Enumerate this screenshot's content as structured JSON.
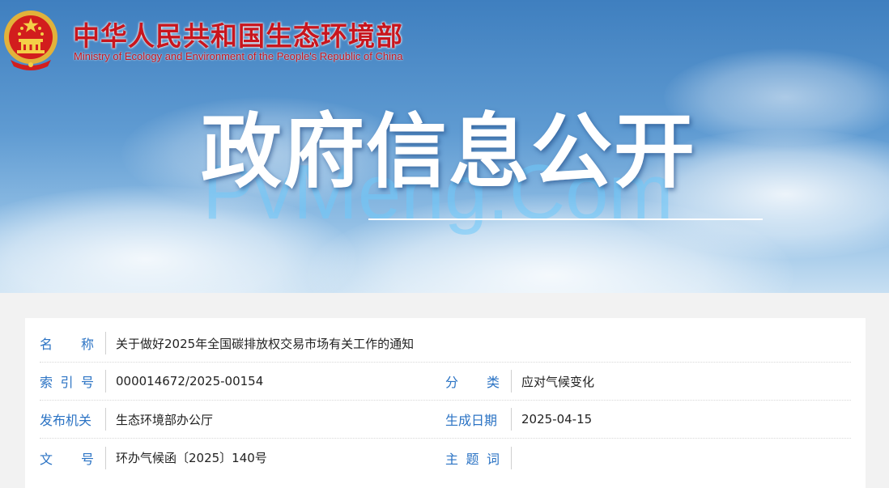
{
  "header": {
    "title_cn": "中华人民共和国生态环境部",
    "title_en": "Ministry of Ecology and Environment of the People's Republic of China",
    "emblem_icon": "national-emblem-icon"
  },
  "banner": {
    "title": "政府信息公开",
    "watermark": "PvMeng.Com"
  },
  "colors": {
    "title_red": "#c8161e",
    "label_blue": "#2b73c4",
    "value_text": "#222222"
  },
  "info": {
    "name": {
      "label": [
        "名",
        "称"
      ],
      "value": "关于做好2025年全国碳排放权交易市场有关工作的通知"
    },
    "index_no": {
      "label": [
        "索",
        "引",
        "号"
      ],
      "value": "000014672/2025-00154"
    },
    "category": {
      "label": [
        "分",
        "类"
      ],
      "value": "应对气候变化"
    },
    "issuer": {
      "label": [
        "发布机关"
      ],
      "value": "生态环境部办公厅"
    },
    "date": {
      "label": [
        "生成日期"
      ],
      "value": "2025-04-15"
    },
    "doc_no": {
      "label": [
        "文",
        "号"
      ],
      "value": "环办气候函〔2025〕140号"
    },
    "keywords": {
      "label": [
        "主",
        "题",
        "词"
      ],
      "value": ""
    }
  }
}
